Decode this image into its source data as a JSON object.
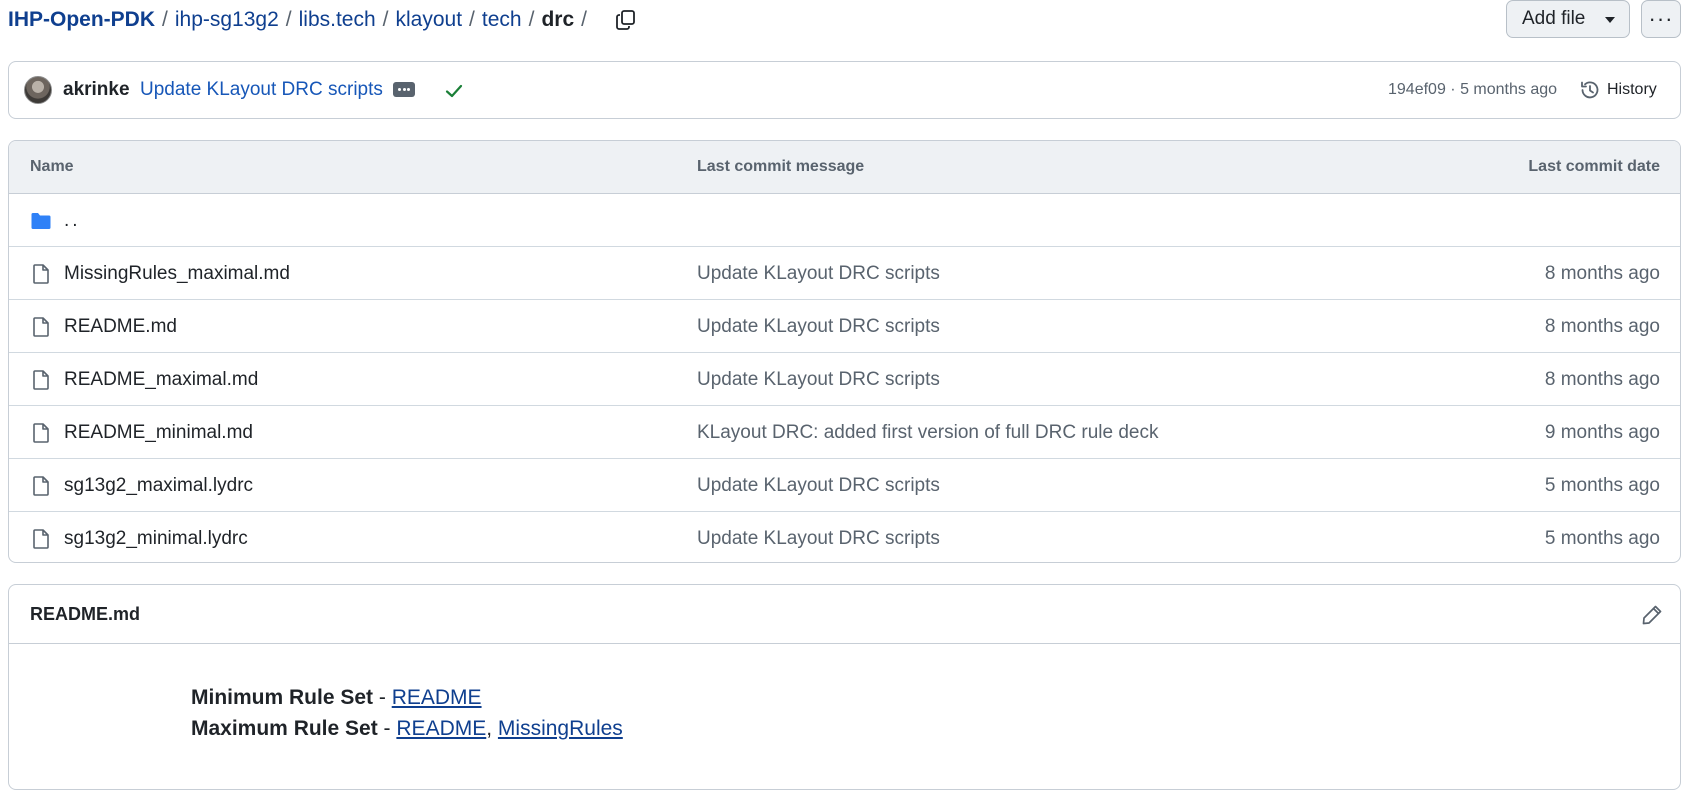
{
  "breadcrumb": {
    "root": "IHP-Open-PDK",
    "parts": [
      "ihp-sg13g2",
      "libs.tech",
      "klayout",
      "tech"
    ],
    "current": "drc",
    "separator": "/"
  },
  "actions": {
    "add_file_label": "Add file",
    "more_label": "···"
  },
  "latest_commit": {
    "author": "akrinke",
    "message": "Update KLayout DRC scripts",
    "sha": "194ef09",
    "meta_separator": " · ",
    "age": "5 months ago",
    "history_label": "History",
    "status": "success"
  },
  "file_table": {
    "headers": {
      "name": "Name",
      "message": "Last commit message",
      "date": "Last commit date"
    },
    "parent_label": "..",
    "rows": [
      {
        "name": "MissingRules_maximal.md",
        "message": "Update KLayout DRC scripts",
        "date": "8 months ago"
      },
      {
        "name": "README.md",
        "message": "Update KLayout DRC scripts",
        "date": "8 months ago"
      },
      {
        "name": "README_maximal.md",
        "message": "Update KLayout DRC scripts",
        "date": "8 months ago"
      },
      {
        "name": "README_minimal.md",
        "message": "KLayout DRC: added first version of full DRC rule deck",
        "date": "9 months ago"
      },
      {
        "name": "sg13g2_maximal.lydrc",
        "message": "Update KLayout DRC scripts",
        "date": "5 months ago"
      },
      {
        "name": "sg13g2_minimal.lydrc",
        "message": "Update KLayout DRC scripts",
        "date": "5 months ago"
      }
    ]
  },
  "readme": {
    "title": "README.md",
    "line1": {
      "label": "Minimum Rule Set",
      "dash": " - ",
      "link": "README"
    },
    "line2": {
      "label": "Maximum Rule Set",
      "dash": " - ",
      "link1": "README",
      "comma": ", ",
      "link2": "MissingRules"
    }
  },
  "colors": {
    "link": "#0f3f8f",
    "commit_link": "#1757b8",
    "folder": "#2f81f7",
    "success": "#1a7f37"
  }
}
